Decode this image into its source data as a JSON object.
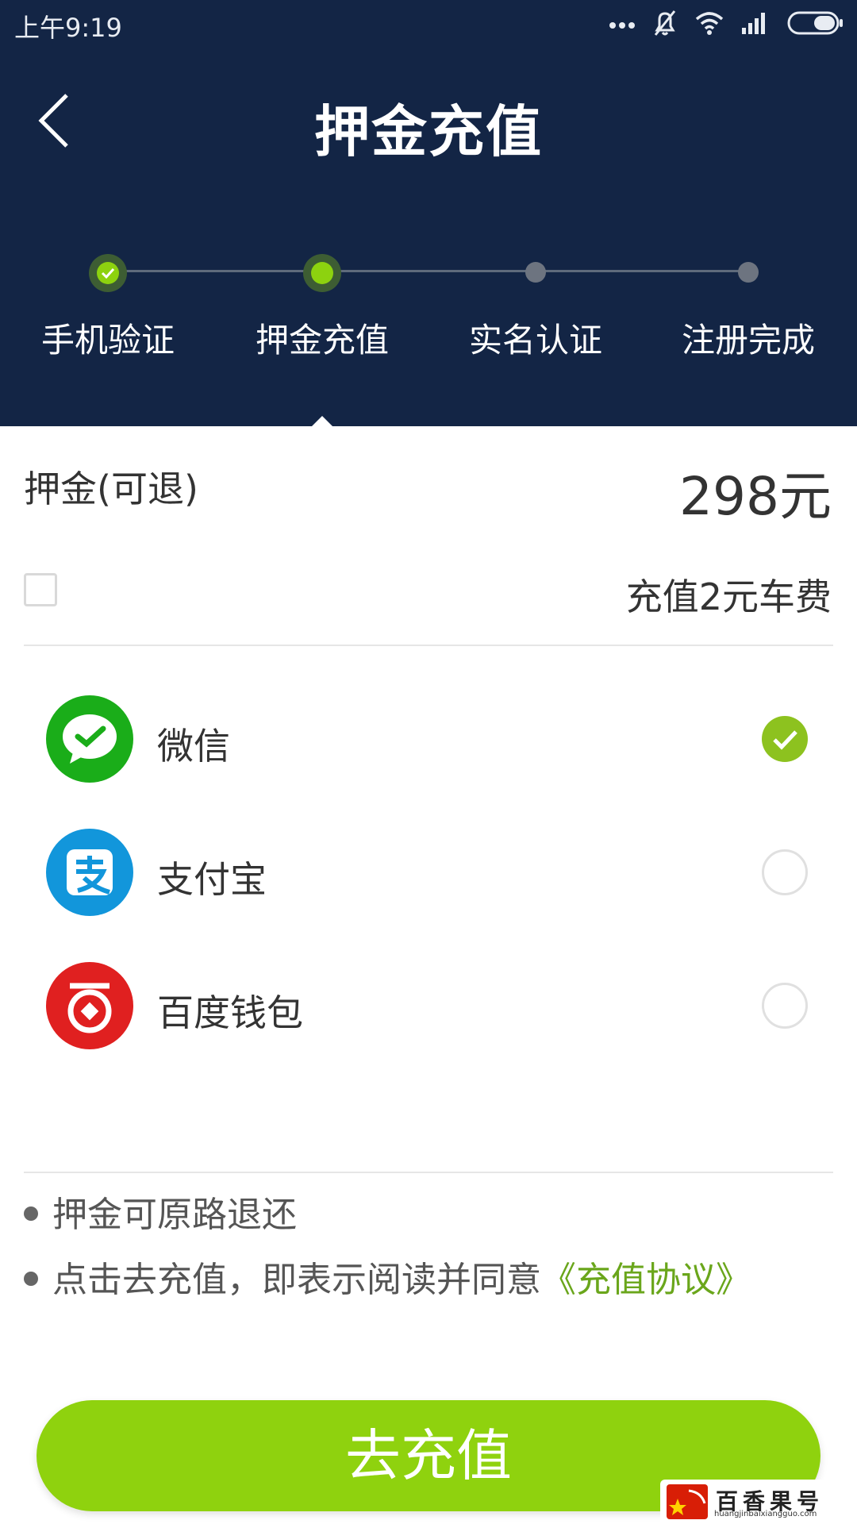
{
  "status_bar": {
    "time": "上午9:19"
  },
  "header": {
    "title": "押金充值"
  },
  "steps": [
    {
      "label": "手机验证",
      "state": "done"
    },
    {
      "label": "押金充值",
      "state": "current"
    },
    {
      "label": "实名认证",
      "state": "pending"
    },
    {
      "label": "注册完成",
      "state": "pending"
    }
  ],
  "deposit": {
    "label": "押金(可退)",
    "amount": "298元"
  },
  "fare_option": {
    "label": "充值2元车费",
    "checked": false
  },
  "payment_methods": [
    {
      "label": "微信",
      "icon": "wechat-icon",
      "color": "#1aad19",
      "selected": true
    },
    {
      "label": "支付宝",
      "icon": "alipay-icon",
      "color": "#1296db",
      "selected": false
    },
    {
      "label": "百度钱包",
      "icon": "baidu-wallet-icon",
      "color": "#e02020",
      "selected": false
    }
  ],
  "notes": {
    "refund": "押金可原路退还",
    "agreement_prefix": "点击去充值，即表示阅读并同意",
    "agreement_link": "《充值协议》"
  },
  "submit": {
    "label": "去充值"
  },
  "watermark": {
    "name": "百香果号",
    "url": "huangjinbaixiangguo.com"
  },
  "colors": {
    "header_bg": "#132545",
    "accent_green": "#8fd20e",
    "link_green": "#6aa61b"
  }
}
